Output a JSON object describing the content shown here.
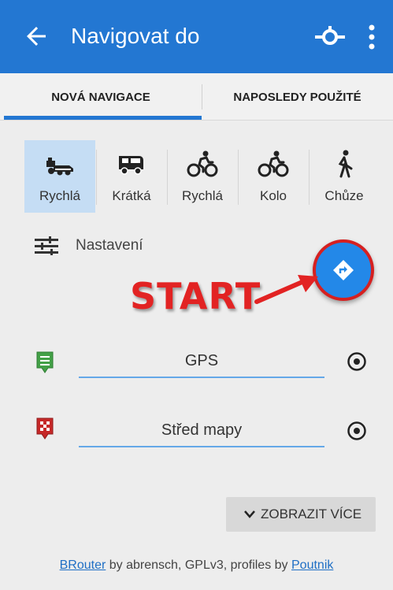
{
  "appbar": {
    "title": "Navigovat do",
    "back_icon": "arrow-left-icon",
    "pin_icon": "map-pin-target-icon",
    "more_icon": "more-vertical-icon",
    "color": "#2377d2"
  },
  "tabs": [
    {
      "label": "NOVÁ NAVIGACE",
      "selected": true
    },
    {
      "label": "NAPOSLEDY POUŽITÉ",
      "selected": false
    }
  ],
  "modes": [
    {
      "label": "Rychlá",
      "icon": "car-icon",
      "selected": true
    },
    {
      "label": "Krátká",
      "icon": "van-icon",
      "selected": false
    },
    {
      "label": "Rychlá",
      "icon": "road-bike-icon",
      "selected": false
    },
    {
      "label": "Kolo",
      "icon": "bicycle-icon",
      "selected": false
    },
    {
      "label": "Chůze",
      "icon": "walking-icon",
      "selected": false
    }
  ],
  "settings": {
    "label": "Nastavení",
    "icon": "sliders-icon"
  },
  "fab": {
    "icon": "navigation-turn-icon",
    "color": "#2388e8",
    "highlight": "#d62020"
  },
  "annotation": {
    "text": "START",
    "color": "#e22323"
  },
  "route": {
    "start": {
      "value": "GPS",
      "icon": "start-flag-green-icon"
    },
    "end": {
      "value": "Střed mapy",
      "icon": "finish-flag-red-icon"
    }
  },
  "more_button": {
    "label": "ZOBRAZIT VÍCE"
  },
  "footer": {
    "brouter": "BRouter",
    "by": "by abrensch, GPLv3, profiles by",
    "poutnik": "Poutnik"
  }
}
